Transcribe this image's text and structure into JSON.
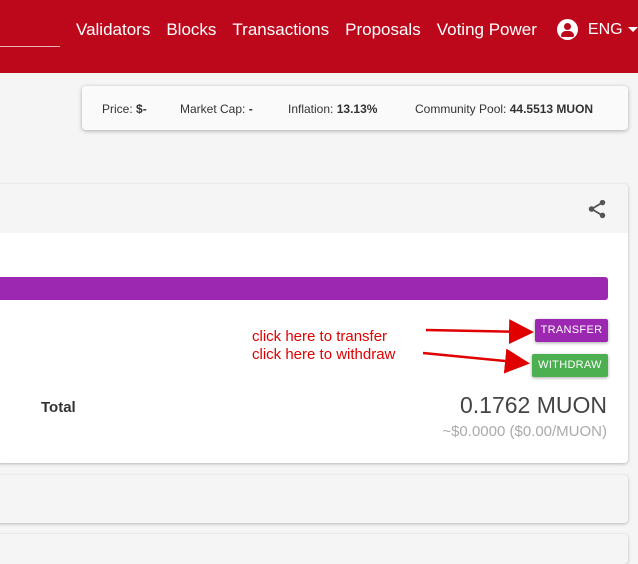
{
  "nav": {
    "items": [
      {
        "label": "Validators"
      },
      {
        "label": "Blocks"
      },
      {
        "label": "Transactions"
      },
      {
        "label": "Proposals"
      },
      {
        "label": "Voting Power"
      }
    ],
    "language": "ENG"
  },
  "stats": {
    "price_label": "Price:",
    "price_value": "$-",
    "market_cap_label": "Market Cap:",
    "market_cap_value": "-",
    "inflation_label": "Inflation:",
    "inflation_value": "13.13%",
    "community_pool_label": "Community Pool:",
    "community_pool_value": "44.5513 MUON"
  },
  "account": {
    "transfer_label": "TRANSFER",
    "withdraw_label": "WITHDRAW",
    "annotation_transfer": "click here to transfer",
    "annotation_withdraw": "click here to withdraw",
    "total_label": "Total",
    "total_value": "0.1762 MUON",
    "total_fiat": "~$0.0000 ($0.00/MUON)"
  },
  "colors": {
    "header": "#bd081c",
    "transfer": "#9c27b0",
    "withdraw": "#4caf50",
    "annotation": "#e00000"
  },
  "icons": {
    "user": "account-circle-icon",
    "share": "share-icon"
  }
}
